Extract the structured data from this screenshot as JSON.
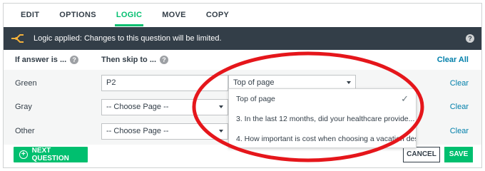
{
  "tabs": [
    {
      "label": "EDIT"
    },
    {
      "label": "OPTIONS"
    },
    {
      "label": "LOGIC",
      "active": true
    },
    {
      "label": "MOVE"
    },
    {
      "label": "COPY"
    }
  ],
  "banner": {
    "text": "Logic applied: Changes to this question will be limited.",
    "help": "?"
  },
  "columns": {
    "answer_header": "If answer is ...",
    "skip_header": "Then skip to ...",
    "help": "?",
    "clear_all": "Clear All"
  },
  "rows": [
    {
      "answer": "Green",
      "page": "P2",
      "skip": "Top of page",
      "clear": "Clear"
    },
    {
      "answer": "Gray",
      "page": "-- Choose Page --",
      "clear": "Clear"
    },
    {
      "answer": "Other",
      "page": "-- Choose Page --",
      "clear": "Clear"
    }
  ],
  "dropdown": {
    "options": [
      {
        "label": "Top of page",
        "selected": true,
        "check": "✓"
      },
      {
        "label": "3. In the last 12 months, did your healthcare provide..."
      },
      {
        "label": "4. How important is cost when choosing a vacation des..."
      }
    ]
  },
  "footer": {
    "next_label": "NEXT QUESTION",
    "cancel_label": "CANCEL",
    "save_label": "SAVE"
  },
  "colors": {
    "accent": "#00bf6f",
    "banner_bg": "#333e48",
    "link": "#007faa",
    "annotation": "#e5161b"
  }
}
